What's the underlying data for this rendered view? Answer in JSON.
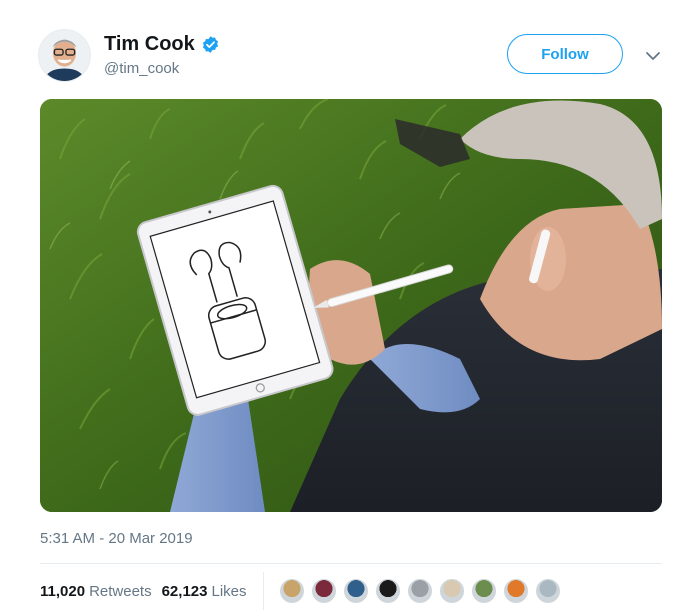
{
  "tweet": {
    "display_name": "Tim Cook",
    "handle": "@tim_cook",
    "verified": true,
    "follow_label": "Follow",
    "timestamp": "5:31 AM - 20 Mar 2019",
    "retweets_count": "11,020",
    "retweets_label": "Retweets",
    "likes_count": "62,123",
    "likes_label": "Likes"
  },
  "colors": {
    "accent": "#1da1f2",
    "secondary_text": "#657786",
    "divider": "#e6ecf0"
  },
  "icons": {
    "verified": "verified-badge-icon",
    "more": "chevron-down-icon"
  },
  "liker_avatar_colors": [
    "#c9a46a",
    "#7a2a3a",
    "#2f5f8a",
    "#1a1a1a",
    "#9aa0a6",
    "#d8c9b0",
    "#6b8e4e",
    "#e07a2a",
    "#aab8c2"
  ]
}
